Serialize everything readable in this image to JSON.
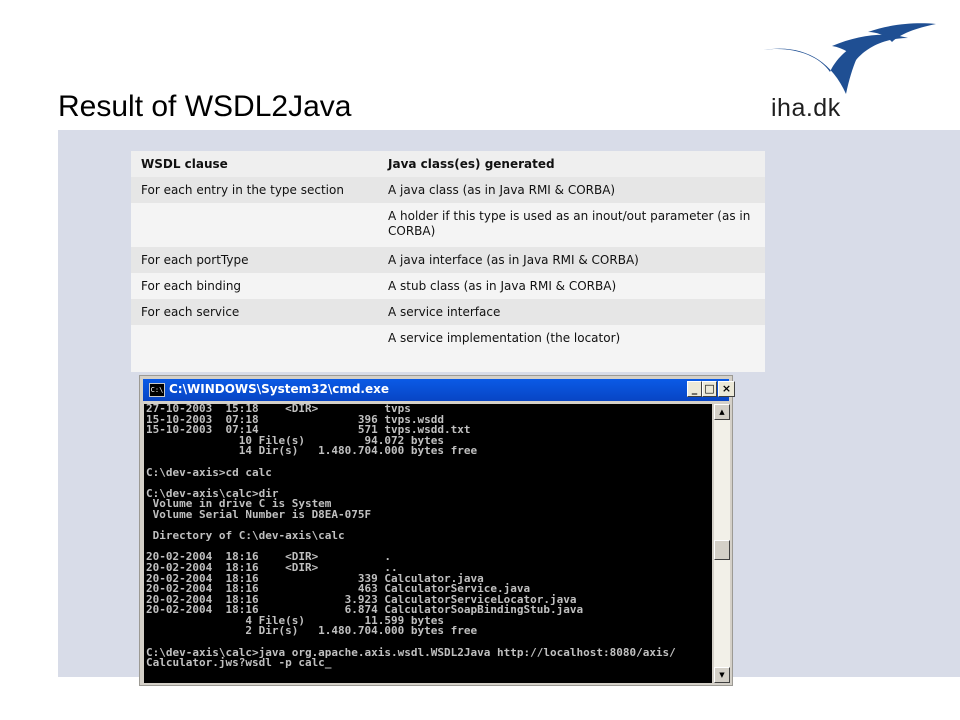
{
  "slide": {
    "title": "Result of WSDL2Java",
    "logo_text": "iha.dk"
  },
  "colors": {
    "logo_blue": "#1f4f93",
    "band": "#d8dce8",
    "titlebar": "#0a5ae6"
  },
  "table": {
    "headers": [
      "WSDL clause",
      "Java class(es) generated"
    ],
    "rows": [
      [
        "For each entry in the type section",
        "A java class (as in Java RMI & CORBA)"
      ],
      [
        "",
        "A holder if this type is used as an inout/out parameter (as in CORBA)"
      ],
      [
        "For each portType",
        "A java interface (as in Java RMI & CORBA)"
      ],
      [
        "For each binding",
        "A stub class (as in Java RMI & CORBA)"
      ],
      [
        "For each service",
        "A service interface"
      ],
      [
        "",
        "A service implementation (the locator)"
      ]
    ]
  },
  "cmd": {
    "title": "C:\\WINDOWS\\System32\\cmd.exe",
    "icon_label": "C:\\",
    "minimize": "_",
    "maximize": "□",
    "close": "×",
    "scroll_up": "▲",
    "scroll_down": "▼",
    "lines": [
      "27-10-2003  15:18    <DIR>          tvps",
      "15-10-2003  07:18               396 tvps.wsdd",
      "15-10-2003  07:14               571 tvps.wsdd.txt",
      "              10 File(s)         94.072 bytes",
      "              14 Dir(s)   1.480.704.000 bytes free",
      "",
      "C:\\dev-axis>cd calc",
      "",
      "C:\\dev-axis\\calc>dir",
      " Volume in drive C is System",
      " Volume Serial Number is D8EA-075F",
      "",
      " Directory of C:\\dev-axis\\calc",
      "",
      "20-02-2004  18:16    <DIR>          .",
      "20-02-2004  18:16    <DIR>          ..",
      "20-02-2004  18:16               339 Calculator.java",
      "20-02-2004  18:16               463 CalculatorService.java",
      "20-02-2004  18:16             3.923 CalculatorServiceLocator.java",
      "20-02-2004  18:16             6.874 CalculatorSoapBindingStub.java",
      "               4 File(s)         11.599 bytes",
      "               2 Dir(s)   1.480.704.000 bytes free",
      "",
      "C:\\dev-axis\\calc>java org.apache.axis.wsdl.WSDL2Java http://localhost:8080/axis/",
      "Calculator.jws?wsdl -p calc"
    ],
    "cursor": "_"
  }
}
